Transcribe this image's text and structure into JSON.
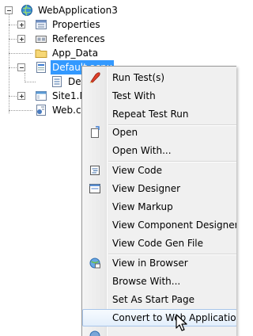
{
  "tree": {
    "root": "WebApplication3",
    "items": [
      {
        "label": "Properties"
      },
      {
        "label": "References"
      },
      {
        "label": "App_Data"
      },
      {
        "label": "Default.aspx"
      },
      {
        "label": "Def"
      },
      {
        "label": "Site1.M"
      },
      {
        "label": "Web.co"
      }
    ]
  },
  "menu": {
    "items": [
      {
        "label": "Run Test(s)",
        "icon": "run-test-icon"
      },
      {
        "label": "Test With"
      },
      {
        "label": "Repeat Test Run"
      },
      {
        "label": "Open",
        "icon": "open-icon"
      },
      {
        "label": "Open With..."
      },
      {
        "label": "View Code",
        "icon": "view-code-icon"
      },
      {
        "label": "View Designer",
        "icon": "view-designer-icon"
      },
      {
        "label": "View Markup"
      },
      {
        "label": "View Component Designer"
      },
      {
        "label": "View Code Gen File"
      },
      {
        "label": "View in Browser",
        "icon": "browser-icon"
      },
      {
        "label": "Browse With..."
      },
      {
        "label": "Set As Start Page"
      },
      {
        "label": "Convert to Web Application"
      }
    ],
    "hover_index": 13
  },
  "colors": {
    "selection": "#3399ff",
    "menu_bg": "#f0f0f0",
    "hover_border": "#a9c6ea"
  }
}
